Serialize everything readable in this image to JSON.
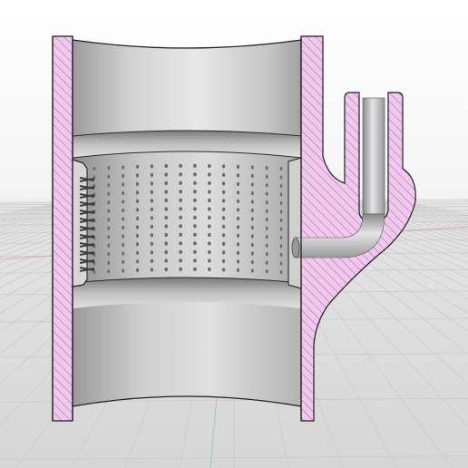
{
  "viewport": {
    "background_top": "#ffffff",
    "background_horizon": "#eaeaea",
    "ground_color": "#d9d9d9",
    "grid_line_color": "#c4c4c4",
    "axis_red": "#d48a8a",
    "axis_green": "#7fbf7f"
  },
  "model": {
    "section_fill": "#f0c8ee",
    "section_hatch": "#a05a9f",
    "edge_color": "#1e1e1e",
    "metal_light": "#e6e6e6",
    "metal_mid": "#b9b9b9",
    "metal_dark": "#8a8a8a",
    "hole_color": "#6a6a6a",
    "spring_color": "#3c3c3c"
  }
}
